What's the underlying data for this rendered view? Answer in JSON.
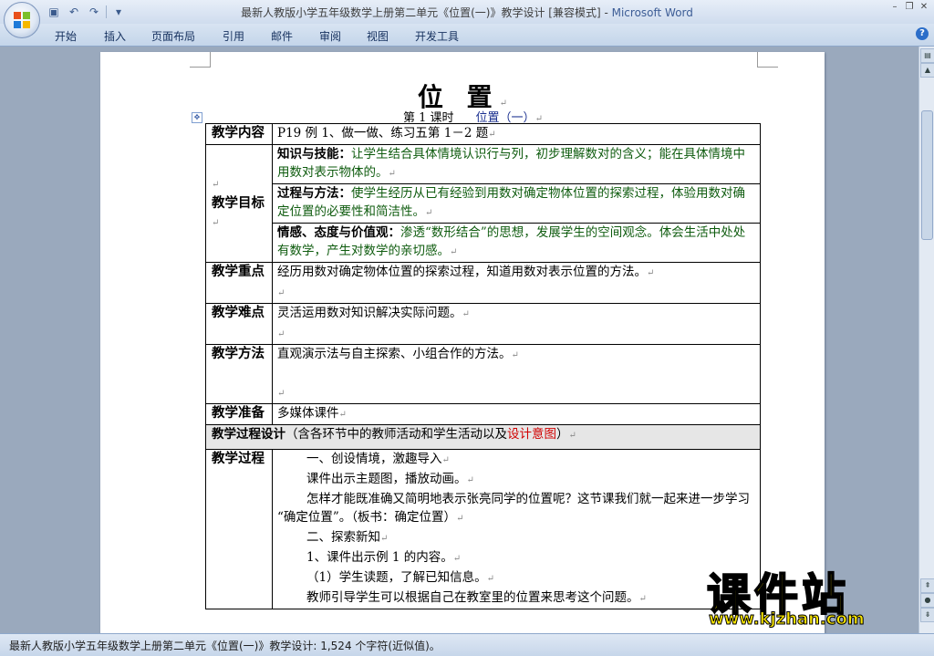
{
  "window": {
    "title_doc": "最新人教版小学五年级数学上册第二单元《位置(一)》教学设计 [兼容模式] - ",
    "title_app": "Microsoft Word"
  },
  "ribbon": {
    "tabs": [
      "开始",
      "插入",
      "页面布局",
      "引用",
      "邮件",
      "审阅",
      "视图",
      "开发工具"
    ]
  },
  "icons": {
    "office": "office-logo-icon",
    "save": "save-icon",
    "undo": "undo-icon",
    "redo": "redo-icon",
    "customize": "qat-dropdown-icon",
    "help": "help-icon"
  },
  "colors": {
    "titlebar": "#d5e1f1",
    "workspace": "#9aa9bd",
    "objective_text": "#0e5b0e",
    "highlight_red": "#d10000",
    "watermark": "#f7e400"
  },
  "doc": {
    "title": "位    置",
    "subtitle_lesson": "第 1 课时",
    "subtitle_name": "位置（一）",
    "para_mark": "↵"
  },
  "table": {
    "content_label": "教学内容",
    "content_text": "P19 例 1、做一做、练习五第 1－2 题",
    "goals_label": "教学目标",
    "goal1_head": "知识与技能：",
    "goal1_text": "让学生结合具体情境认识行与列，初步理解数对的含义；能在具体情境中用数对表示物体的。",
    "goal2_head": "过程与方法：",
    "goal2_text": "使学生经历从已有经验到用数对确定物体位置的探索过程，体验用数对确定位置的必要性和简洁性。",
    "goal3_head": "情感、态度与价值观：",
    "goal3_text": "渗透“数形结合”的思想，发展学生的空间观念。体会生活中处处有数学，产生对数学的亲切感。",
    "key_label": "教学重点",
    "key_text": "经历用数对确定物体位置的探索过程，知道用数对表示位置的方法。",
    "difficulty_label": "教学难点",
    "difficulty_text": "灵活运用数对知识解决实际问题。",
    "method_label": "教学方法",
    "method_text": "直观演示法与自主探索、小组合作的方法。",
    "prep_label": "教学准备",
    "prep_text": "多媒体课件",
    "design_head": "教学过程设计",
    "design_note_a": "（含各环节中的教师活动和学生活动以及",
    "design_note_red": "设计意图",
    "design_note_b": "）",
    "process_label": "教学过程",
    "process_lines": [
      "一、创设情境，激趣导入",
      "课件出示主题图，播放动画。",
      "怎样才能既准确又简明地表示张亮同学的位置呢？这节课我们就一起来进一步学习 “确定位置”。（板书：确定位置）",
      "二、探索新知",
      "1、课件出示例 1 的内容。",
      "（1）学生读题，了解已知信息。",
      "教师引导学生可以根据自己在教室里的位置来思考这个问题。"
    ]
  },
  "status": {
    "text": "最新人教版小学五年级数学上册第二单元《位置(一)》教学设计: 1,524 个字符(近似值)。"
  },
  "watermark": {
    "main": "课件站",
    "url": "www.kjzhan.com"
  }
}
